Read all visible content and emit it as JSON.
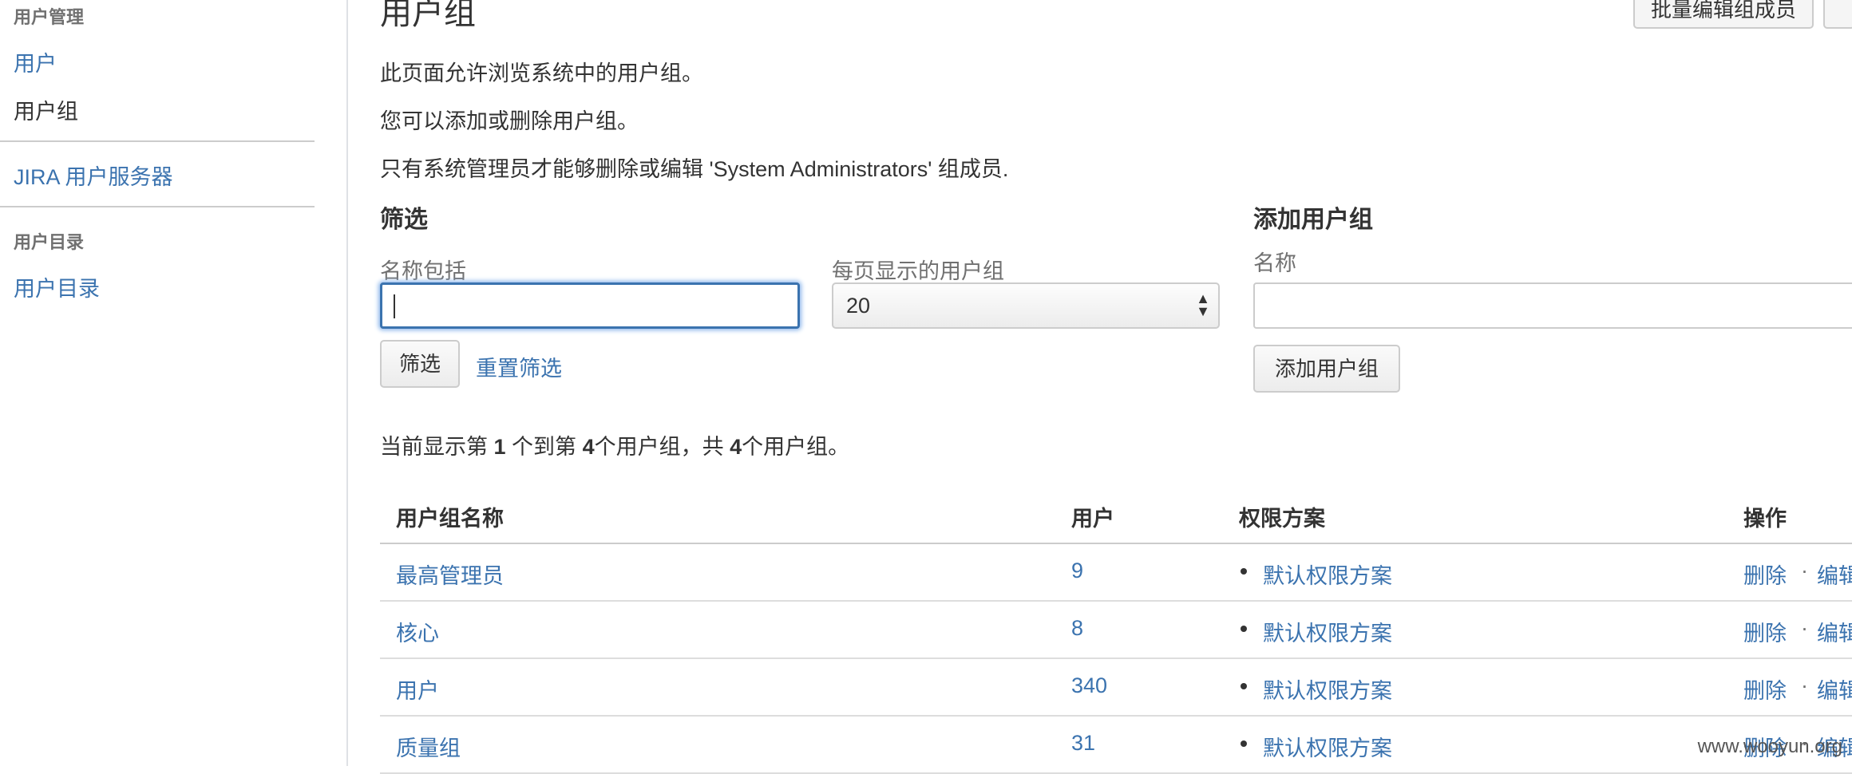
{
  "sidebar": {
    "section_users": "用户管理",
    "link_users": "用户",
    "link_groups": "用户组",
    "link_jira_server": "JIRA 用户服务器",
    "section_directory": "用户目录",
    "link_directory": "用户目录"
  },
  "page": {
    "title": "用户组",
    "bulk_edit_button": "批量编辑组成员",
    "desc1": "此页面允许浏览系统中的用户组。",
    "desc2": "您可以添加或删除用户组。",
    "desc3": "只有系统管理员才能够删除或编辑 'System Administrators' 组成员."
  },
  "filter": {
    "title": "筛选",
    "name_label": "名称包括",
    "name_value": "",
    "per_page_label": "每页显示的用户组",
    "per_page_value": "20",
    "filter_button": "筛选",
    "reset_link": "重置筛选"
  },
  "add_group": {
    "title": "添加用户组",
    "name_label": "名称",
    "name_value": "",
    "add_button": "添加用户组"
  },
  "summary": {
    "prefix": "当前显示第 ",
    "from": "1",
    "middle": " 个到第 ",
    "to": "4",
    "middle2": "个用户组，共 ",
    "total": "4",
    "suffix": "个用户组。"
  },
  "table": {
    "headers": [
      "用户组名称",
      "用户",
      "权限方案",
      "操作"
    ],
    "rows": [
      {
        "name": "最高管理员",
        "users": "9",
        "scheme": "默认权限方案",
        "delete": "删除",
        "edit": "编辑"
      },
      {
        "name": "核心",
        "users": "8",
        "scheme": "默认权限方案",
        "delete": "删除",
        "edit": "编辑"
      },
      {
        "name": "用户",
        "users": "340",
        "scheme": "默认权限方案",
        "delete": "删除",
        "edit": "编辑"
      },
      {
        "name": "质量组",
        "users": "31",
        "scheme": "默认权限方案",
        "delete": "删除",
        "edit": "编辑"
      }
    ],
    "separator": "·"
  },
  "watermark": "www.wooyun.org"
}
